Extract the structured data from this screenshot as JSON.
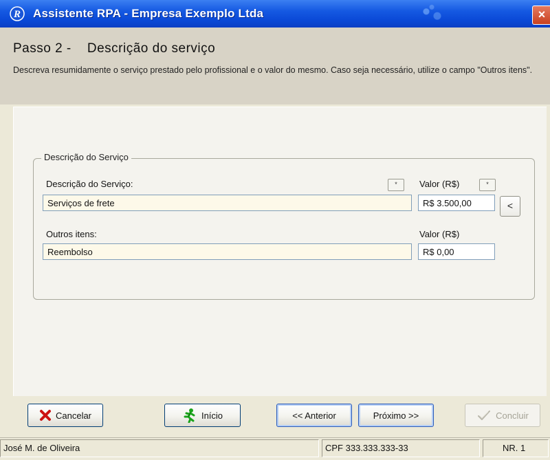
{
  "window": {
    "title": "Assistente RPA - Empresa Exemplo Ltda",
    "close_glyph": "×"
  },
  "header": {
    "step_title": "Passo 2 -    Descrição do serviço",
    "description": "Descreva resumidamente o serviço prestado pelo profissional e o valor do mesmo. Caso seja necessário, utilize o campo \"Outros itens\"."
  },
  "group": {
    "legend": "Descrição do Serviço",
    "service_label": "Descrição do Serviço:",
    "service_value": "Serviços de frete",
    "value_label_1": "Valor (R$)",
    "value_1": "R$ 3.500,00",
    "other_label": "Outros itens:",
    "other_value": "Reembolso",
    "value_label_2": "Valor (R$)",
    "value_2": "R$ 0,00",
    "small_button_glyph": "*",
    "arrow_button_glyph": "<"
  },
  "buttons": {
    "cancel": "Cancelar",
    "start": "Início",
    "previous": "<< Anterior",
    "next": "Próximo >>",
    "finish": "Concluir"
  },
  "status": {
    "name": "José M. de Oliveira",
    "cpf": "CPF 333.333.333-33",
    "nr": "NR. 1"
  },
  "colors": {
    "titlebar": "#0a48d6",
    "header_bg": "#d8d3c6",
    "input_bg": "#fdf9e9",
    "cancel_icon": "#cc1111",
    "start_icon": "#1aa31a"
  },
  "icons": {
    "app": "app-logo-icon",
    "cancel": "red-x-icon",
    "start": "running-man-icon",
    "finish": "check-icon"
  }
}
